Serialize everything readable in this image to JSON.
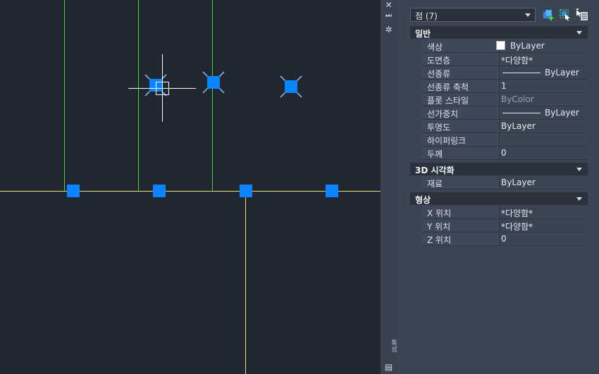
{
  "canvas": {
    "grips": [
      "crosshair-grip",
      "selected-point-grip",
      "selected-point-grip",
      "point-grip",
      "point-grip",
      "point-grip",
      "point-grip"
    ]
  },
  "palette_strip": {
    "close_icon": "✕",
    "pin_icon": "⏭",
    "settings_icon": "✲",
    "vertical_label": "특성",
    "panel_icon": "▤"
  },
  "properties": {
    "selection": "점 (7)",
    "sections": {
      "general": {
        "title": "일반",
        "rows": [
          {
            "label": "색상",
            "value": "ByLayer"
          },
          {
            "label": "도면층",
            "value": "*다양함*"
          },
          {
            "label": "선종류",
            "value": "ByLayer"
          },
          {
            "label": "선종류 축척",
            "value": "1"
          },
          {
            "label": "플롯 스타일",
            "value": "ByColor"
          },
          {
            "label": "선가중치",
            "value": "ByLayer"
          },
          {
            "label": "투명도",
            "value": "ByLayer"
          },
          {
            "label": "하이퍼링크",
            "value": ""
          },
          {
            "label": "두께",
            "value": "0"
          }
        ]
      },
      "viz3d": {
        "title": "3D 시각화",
        "rows": [
          {
            "label": "재료",
            "value": "ByLayer"
          }
        ]
      },
      "geometry": {
        "title": "형상",
        "rows": [
          {
            "label": "X 위치",
            "value": "*다양함*"
          },
          {
            "label": "Y 위치",
            "value": "*다양함*"
          },
          {
            "label": "Z 위치",
            "value": "0"
          }
        ]
      }
    }
  },
  "colors": {
    "canvas_bg": "#212730",
    "green_line": "#4dd04a",
    "yellow_line": "#e8e07a",
    "grip_blue": "#0a84ff"
  }
}
